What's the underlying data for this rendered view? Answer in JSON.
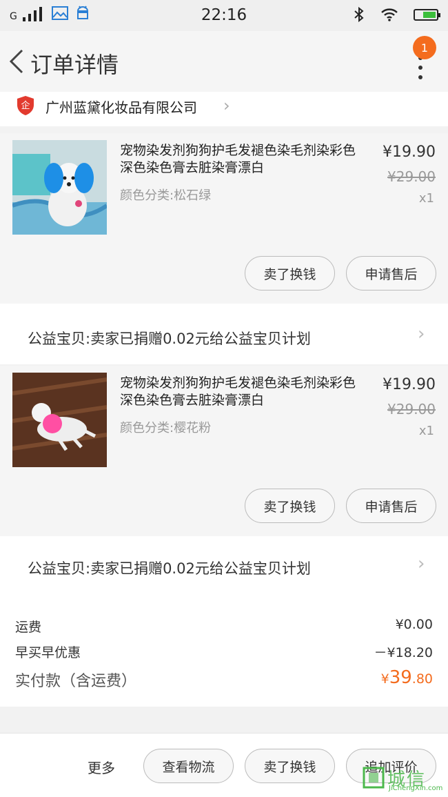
{
  "status_bar": {
    "carrier": "G",
    "time": "22:16"
  },
  "nav": {
    "title": "订单详情",
    "badge_count": "1"
  },
  "shop": {
    "icon_text": "企",
    "name": "广州蓝黛化妆品有限公司"
  },
  "items": [
    {
      "title": "宠物染发剂狗狗护毛发褪色染毛剂染彩色深色染色膏去脏染膏漂白",
      "sku": "颜色分类:松石绿",
      "price": "¥19.90",
      "original_price": "¥29.00",
      "quantity": "x1",
      "btn_sell": "卖了换钱",
      "btn_aftersale": "申请售后",
      "charity": "公益宝贝:卖家已捐赠0.02元给公益宝贝计划"
    },
    {
      "title": "宠物染发剂狗狗护毛发褪色染毛剂染彩色深色染色膏去脏染膏漂白",
      "sku": "颜色分类:樱花粉",
      "price": "¥19.90",
      "original_price": "¥29.00",
      "quantity": "x1",
      "btn_sell": "卖了换钱",
      "btn_aftersale": "申请售后",
      "charity": "公益宝贝:卖家已捐赠0.02元给公益宝贝计划"
    }
  ],
  "summary": {
    "shipping_label": "运费",
    "shipping_value": "¥0.00",
    "discount_label": "早买早优惠",
    "discount_value": "－¥18.20",
    "paid_label": "实付款（含运费）",
    "paid_currency": "¥",
    "paid_int": "39",
    "paid_dec": ".80"
  },
  "bottom_bar": {
    "more": "更多",
    "logistics": "查看物流",
    "sell": "卖了换钱",
    "review": "追加评价"
  },
  "watermark": {
    "text": "城信",
    "sub": "JiChengXin.com"
  },
  "colors": {
    "accent": "#f46c1e",
    "shop_badge": "#e23a2e",
    "watermark": "#4cb84c"
  }
}
